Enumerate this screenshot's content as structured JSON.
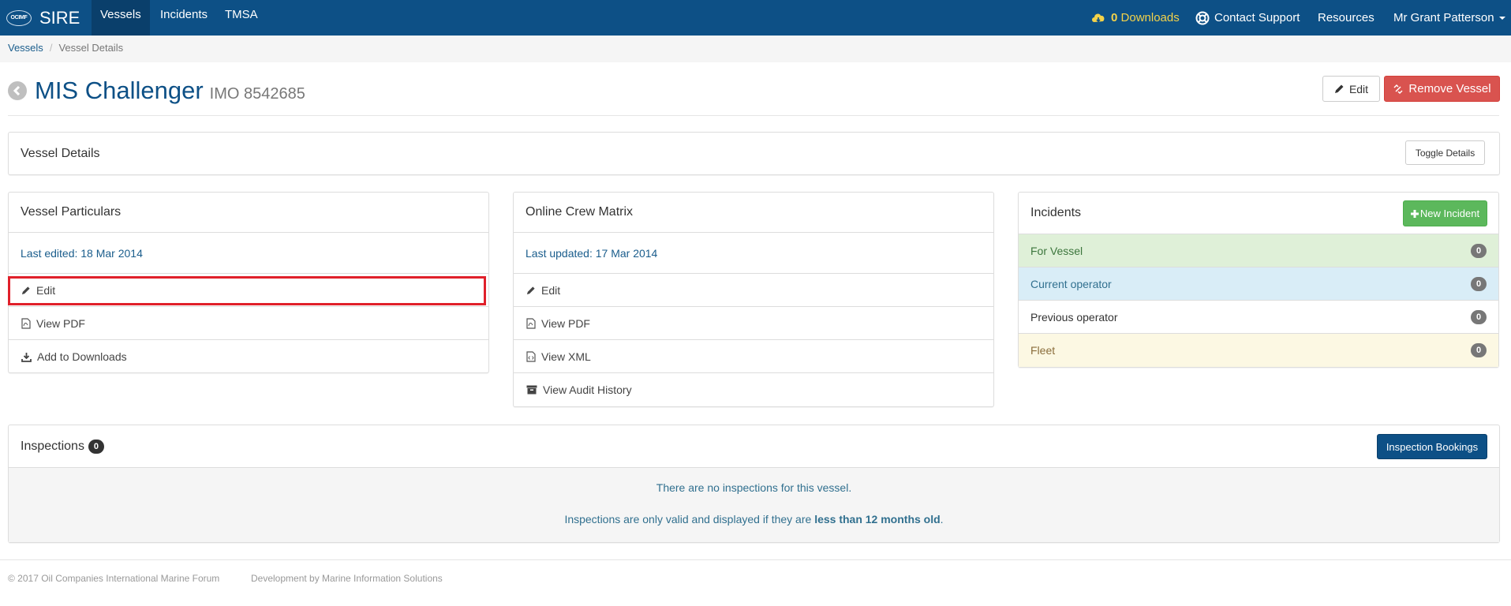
{
  "nav": {
    "logo_text": "OCIMF",
    "brand": "SIRE",
    "links": [
      "Vessels",
      "Incidents",
      "TMSA"
    ],
    "downloads_count": "0",
    "downloads_label": "Downloads",
    "contact_support": "Contact Support",
    "resources": "Resources",
    "user": "Mr Grant Patterson"
  },
  "breadcrumb": {
    "root": "Vessels",
    "sep": "/",
    "current": "Vessel Details"
  },
  "page": {
    "vessel_name": "MIS Challenger",
    "imo": "IMO 8542685",
    "edit_label": "Edit",
    "remove_label": "Remove Vessel"
  },
  "vessel_details": {
    "title": "Vessel Details",
    "toggle_label": "Toggle Details"
  },
  "particulars": {
    "title": "Vessel Particulars",
    "last_edited": "Last edited: 18 Mar 2014",
    "items": [
      "Edit",
      "View PDF",
      "Add to Downloads"
    ],
    "icons": [
      "pencil-icon",
      "pdf-file-icon",
      "download-icon"
    ]
  },
  "crew_matrix": {
    "title": "Online Crew Matrix",
    "last_updated": "Last updated: 17 Mar 2014",
    "items": [
      "Edit",
      "View PDF",
      "View XML",
      "View Audit History"
    ],
    "icons": [
      "pencil-icon",
      "pdf-file-icon",
      "code-file-icon",
      "archive-icon"
    ]
  },
  "incidents": {
    "title": "Incidents",
    "new_label": "New Incident",
    "rows": [
      {
        "label": "For Vessel",
        "count": "0"
      },
      {
        "label": "Current operator",
        "count": "0"
      },
      {
        "label": "Previous operator",
        "count": "0"
      },
      {
        "label": "Fleet",
        "count": "0"
      }
    ]
  },
  "inspections": {
    "title": "Inspections",
    "count": "0",
    "bookings_label": "Inspection Bookings",
    "none_text": "There are no inspections for this vessel.",
    "valid_prefix": "Inspections are only valid and displayed if they are ",
    "valid_bold": "less than 12 months old",
    "valid_suffix": "."
  },
  "footer": {
    "copyright": "© 2017 Oil Companies International Marine Forum",
    "development": "Development by Marine Information Solutions"
  },
  "colors": {
    "navbar": "#0d5086",
    "danger": "#d9534f",
    "success": "#5cb85c",
    "highlight": "#e0202a"
  }
}
